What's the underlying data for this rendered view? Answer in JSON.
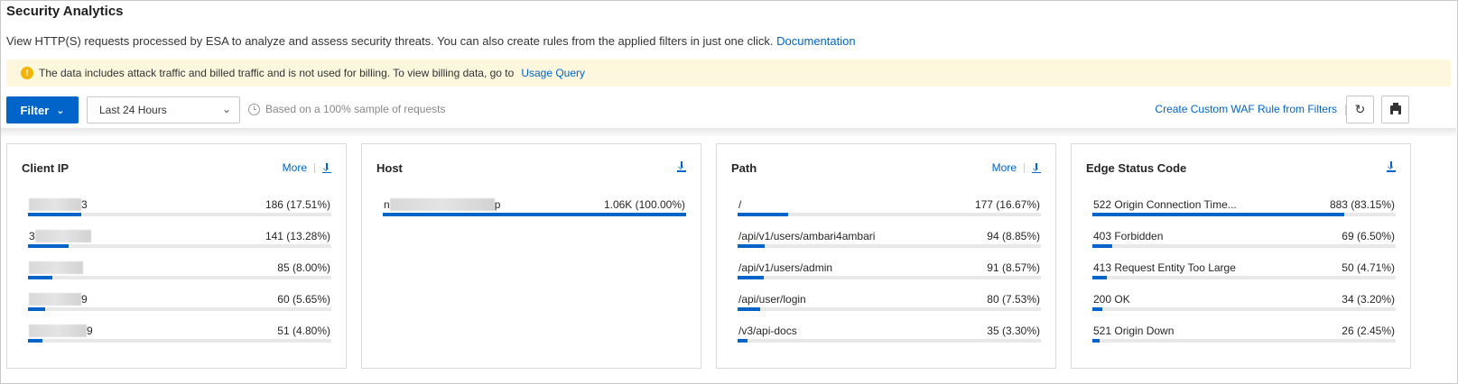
{
  "page": {
    "title": "Security Analytics",
    "description": "View HTTP(S) requests processed by ESA to analyze and assess security threats. You can also create rules from the applied filters in just one click.",
    "doc_link": "Documentation"
  },
  "notice": {
    "icon": "warning-icon",
    "text": "The data includes attack traffic and billed traffic and is not used for billing. To view billing data, go to",
    "link": "Usage Query",
    "color": "#fdf7de"
  },
  "toolbar": {
    "filter_label": "Filter",
    "time_range": "Last 24 Hours",
    "sample_note": "Based on a 100% sample of requests",
    "waf_link": "Create Custom WAF Rule from Filters"
  },
  "colors": {
    "accent": "#0064c8",
    "track": "#e8e8e8"
  },
  "cards": [
    {
      "title": "Client IP",
      "more": "More",
      "rows": [
        {
          "prefix": "",
          "suffix": "3",
          "mask": 58,
          "value": "186 (17.51%)",
          "fraction": 0.1751
        },
        {
          "prefix": "3",
          "suffix": "",
          "mask": 62,
          "value": "141 (13.28%)",
          "fraction": 0.1328
        },
        {
          "prefix": "",
          "suffix": "",
          "mask": 60,
          "value": "85 (8.00%)",
          "fraction": 0.08
        },
        {
          "prefix": "",
          "suffix": "9",
          "mask": 58,
          "value": "60 (5.65%)",
          "fraction": 0.0565
        },
        {
          "prefix": "",
          "suffix": "9",
          "mask": 64,
          "value": "51 (4.80%)",
          "fraction": 0.048
        }
      ]
    },
    {
      "title": "Host",
      "more": "",
      "rows": [
        {
          "prefix": "n",
          "suffix": "p",
          "mask": 116,
          "value": "1.06K (100.00%)",
          "fraction": 1.0
        }
      ]
    },
    {
      "title": "Path",
      "more": "More",
      "rows": [
        {
          "label": "/",
          "value": "177 (16.67%)",
          "fraction": 0.1667
        },
        {
          "label": "/api/v1/users/ambari4ambari",
          "value": "94 (8.85%)",
          "fraction": 0.0885
        },
        {
          "label": "/api/v1/users/admin",
          "value": "91 (8.57%)",
          "fraction": 0.0857
        },
        {
          "label": "/api/user/login",
          "value": "80 (7.53%)",
          "fraction": 0.0753
        },
        {
          "label": "/v3/api-docs",
          "value": "35 (3.30%)",
          "fraction": 0.033
        }
      ]
    },
    {
      "title": "Edge Status Code",
      "more": "",
      "rows": [
        {
          "label": "522 Origin Connection Time...",
          "value": "883 (83.15%)",
          "fraction": 0.8315
        },
        {
          "label": "403 Forbidden",
          "value": "69 (6.50%)",
          "fraction": 0.065
        },
        {
          "label": "413 Request Entity Too Large",
          "value": "50 (4.71%)",
          "fraction": 0.0471
        },
        {
          "label": "200 OK",
          "value": "34 (3.20%)",
          "fraction": 0.032
        },
        {
          "label": "521 Origin Down",
          "value": "26 (2.45%)",
          "fraction": 0.0245
        }
      ]
    }
  ]
}
